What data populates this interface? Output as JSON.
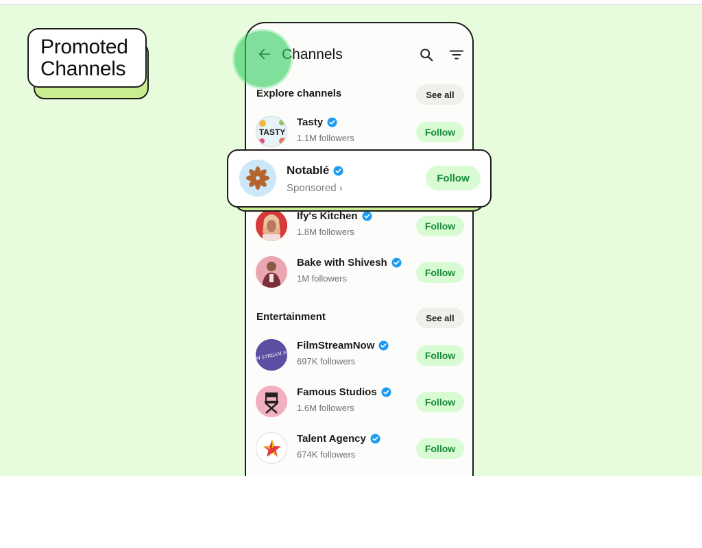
{
  "badge": {
    "line1": "Promoted",
    "line2": "Channels"
  },
  "header": {
    "title": "Channels"
  },
  "sections": [
    {
      "title": "Explore channels",
      "see_all": "See all",
      "channels": [
        {
          "name": "Tasty",
          "followers": "1.1M followers",
          "button": "Follow"
        },
        {
          "name": "Ify's Kitchen",
          "followers": "1.8M followers",
          "button": "Follow"
        },
        {
          "name": "Bake with Shivesh",
          "followers": "1M followers",
          "button": "Follow"
        }
      ]
    },
    {
      "title": "Entertainment",
      "see_all": "See all",
      "channels": [
        {
          "name": "FilmStreamNow",
          "followers": "697K followers",
          "button": "Follow"
        },
        {
          "name": "Famous Studios",
          "followers": "1.6M followers",
          "button": "Follow"
        },
        {
          "name": "Talent Agency",
          "followers": "674K followers",
          "button": "Follow"
        }
      ]
    }
  ],
  "promoted": {
    "name": "Notablé",
    "sponsored": "Sponsored ›",
    "button": "Follow"
  },
  "avatars": {
    "tasty_text": "TASTY",
    "filmstream_text": "FILM STREAM NOW"
  },
  "colors": {
    "background": "#e7fcdc",
    "follow_bg": "#d9fbd4",
    "follow_text": "#168a3a",
    "verified": "#1d9bf0",
    "accent": "#c8ec8e"
  }
}
